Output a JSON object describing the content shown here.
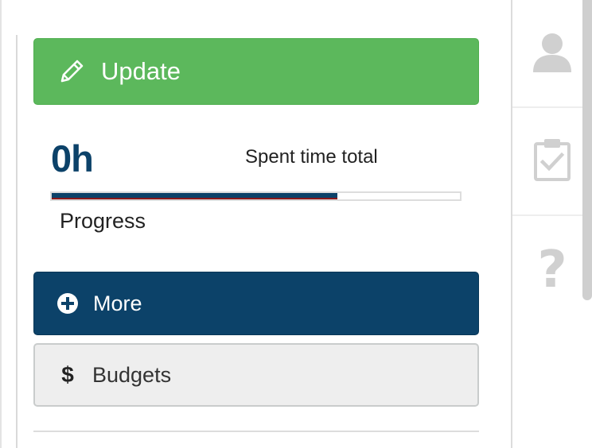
{
  "actions": {
    "update_label": "Update",
    "more_label": "More",
    "budgets_label": "Budgets"
  },
  "time": {
    "value": "0h",
    "label": "Spent time total"
  },
  "progress": {
    "label": "Progress",
    "fraction": 0.7
  },
  "right_rail": {
    "items": [
      {
        "icon": "user-icon"
      },
      {
        "icon": "clipboard-check-icon"
      },
      {
        "icon": "question-icon",
        "glyph": "?"
      }
    ]
  },
  "icons": {
    "update": "pencil-icon",
    "more": "plus-circle-icon",
    "budgets": "dollar-icon",
    "budgets_glyph": "$"
  },
  "colors": {
    "update_bg": "#5cb85c",
    "primary": "#0c4269",
    "budgets_bg": "#eeeeee",
    "rail_icon": "#d0d0d0"
  }
}
